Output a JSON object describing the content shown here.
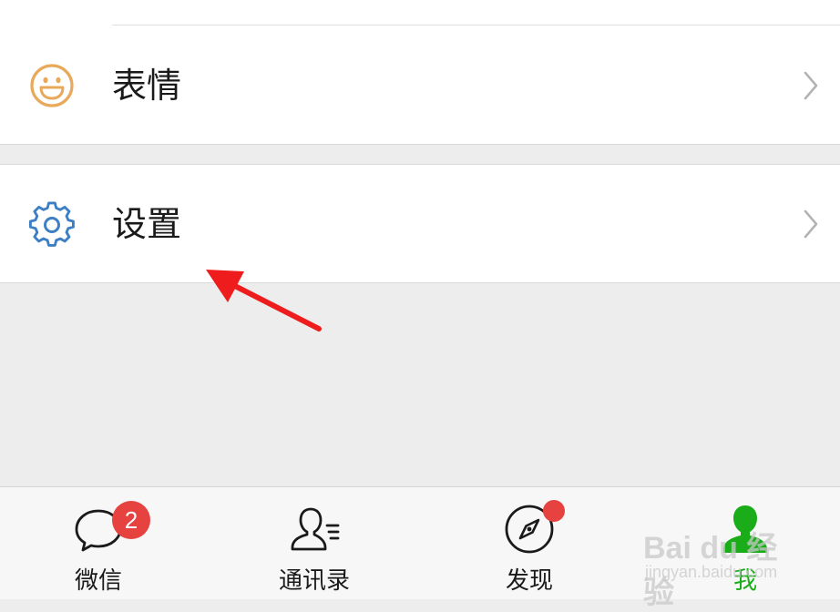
{
  "menu": {
    "emoji": {
      "label": "表情",
      "icon": "emoji-icon"
    },
    "settings": {
      "label": "设置",
      "icon": "gear-icon"
    }
  },
  "tabbar": {
    "tabs": [
      {
        "label": "微信",
        "icon": "chat-bubble-icon",
        "badge": "2"
      },
      {
        "label": "通讯录",
        "icon": "contacts-icon"
      },
      {
        "label": "发现",
        "icon": "compass-icon",
        "dot": true
      },
      {
        "label": "我",
        "icon": "person-icon",
        "active": true
      }
    ]
  },
  "watermark": {
    "main": "Bai du 经验",
    "sub": "jingyan.baidu.com"
  },
  "colors": {
    "accent": "#1aad19",
    "badge": "#e64340",
    "emoji_icon": "#e8a95a",
    "gear_icon": "#3d7fc4",
    "arrow": "#ee1c1c"
  }
}
